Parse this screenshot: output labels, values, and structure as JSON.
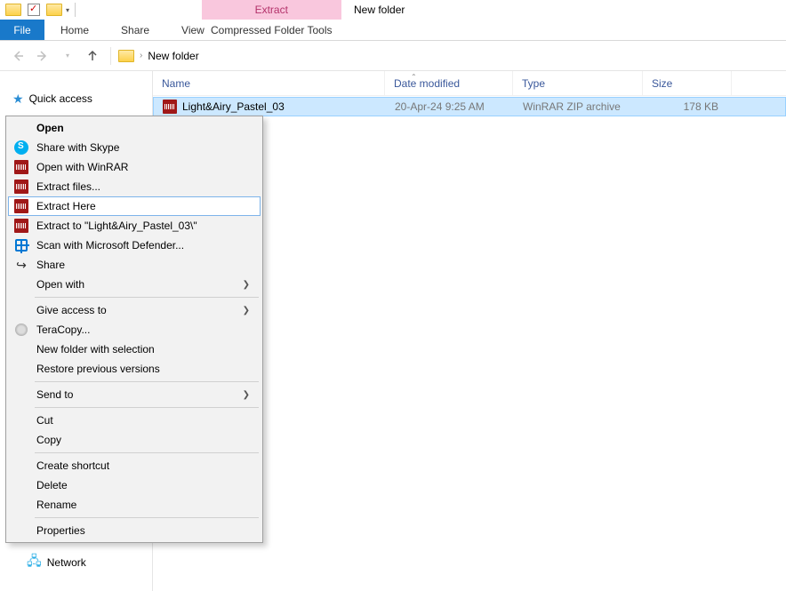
{
  "window_title": "New folder",
  "contextual": {
    "title": "Extract",
    "tab": "Compressed Folder Tools"
  },
  "ribbon": {
    "file": "File",
    "home": "Home",
    "share": "Share",
    "view": "View"
  },
  "address": {
    "location": "New folder"
  },
  "sidebar": {
    "quick_access": "Quick access",
    "network": "Network"
  },
  "columns": {
    "name": "Name",
    "date": "Date modified",
    "type": "Type",
    "size": "Size"
  },
  "rows": [
    {
      "name": "Light&Airy_Pastel_03",
      "date": "20-Apr-24 9:25 AM",
      "type": "WinRAR ZIP archive",
      "size": "178 KB"
    }
  ],
  "context_menu": {
    "open": "Open",
    "share_skype": "Share with Skype",
    "open_winrar": "Open with WinRAR",
    "extract_files": "Extract files...",
    "extract_here": "Extract Here",
    "extract_to": "Extract to \"Light&Airy_Pastel_03\\\"",
    "scan_defender": "Scan with Microsoft Defender...",
    "share": "Share",
    "open_with": "Open with",
    "give_access": "Give access to",
    "teracopy": "TeraCopy...",
    "new_folder_sel": "New folder with selection",
    "restore_prev": "Restore previous versions",
    "send_to": "Send to",
    "cut": "Cut",
    "copy": "Copy",
    "create_shortcut": "Create shortcut",
    "delete": "Delete",
    "rename": "Rename",
    "properties": "Properties"
  }
}
